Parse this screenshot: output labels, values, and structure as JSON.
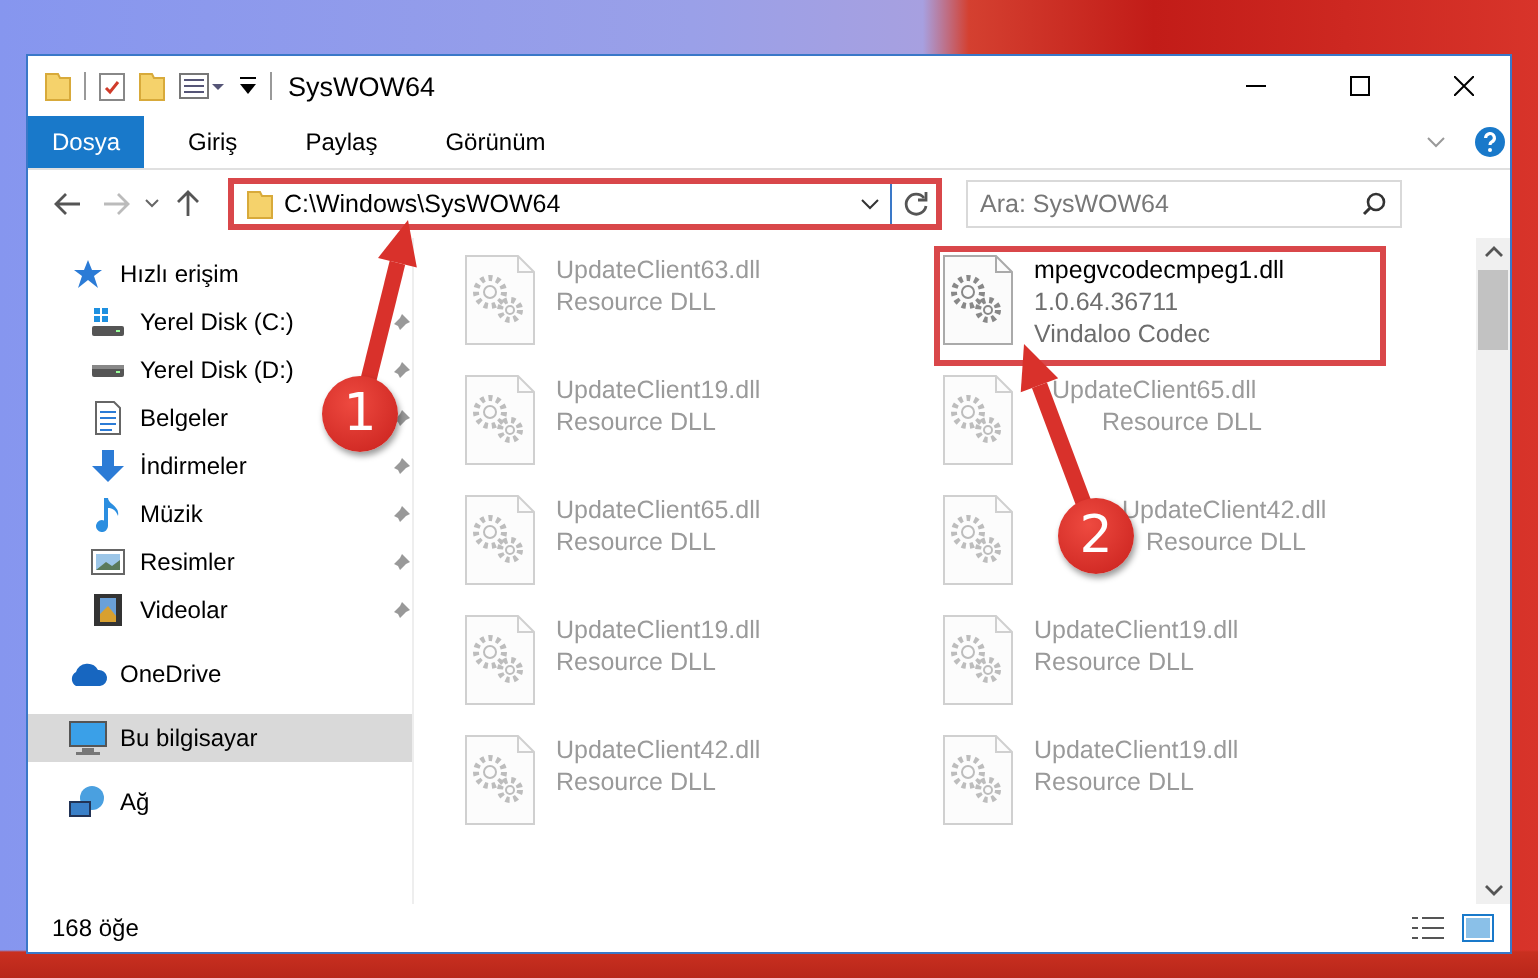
{
  "window": {
    "title": "SysWOW64"
  },
  "ribbon": {
    "tabs": [
      {
        "label": "Dosya",
        "selected": true
      },
      {
        "label": "Giriş",
        "selected": false
      },
      {
        "label": "Paylaş",
        "selected": false
      },
      {
        "label": "Görünüm",
        "selected": false
      }
    ]
  },
  "address_bar": {
    "path": "C:\\Windows\\SysWOW64",
    "highlighted": true
  },
  "search": {
    "placeholder": "Ara: SysWOW64"
  },
  "navigation": [
    {
      "label": "Hızlı erişim",
      "kind": "star",
      "selected": false,
      "children": [
        {
          "label": "Yerel Disk (C:)",
          "kind": "drive-windows",
          "pinned": true,
          "selected": false
        },
        {
          "label": "Yerel Disk (D:)",
          "kind": "drive",
          "pinned": true,
          "selected": false
        },
        {
          "label": "Belgeler",
          "kind": "document",
          "pinned": true,
          "selected": false
        },
        {
          "label": "İndirmeler",
          "kind": "download",
          "pinned": true,
          "selected": false
        },
        {
          "label": "Müzik",
          "kind": "music",
          "pinned": true,
          "selected": false
        },
        {
          "label": "Resimler",
          "kind": "picture",
          "pinned": true,
          "selected": false
        },
        {
          "label": "Videolar",
          "kind": "video",
          "pinned": true,
          "selected": false
        }
      ]
    },
    {
      "label": "OneDrive",
      "kind": "cloud",
      "selected": false
    },
    {
      "label": "Bu bilgisayar",
      "kind": "computer",
      "selected": true
    },
    {
      "label": "Ağ",
      "kind": "network",
      "selected": false
    }
  ],
  "files": [
    {
      "lines": [
        "UpdateClient63.dll",
        "Resource DLL"
      ],
      "faded": true,
      "highlighted": false
    },
    {
      "lines": [
        "mpegvcodecmpeg1.dll",
        "1.0.64.36711",
        "Vindaloo Codec"
      ],
      "faded": false,
      "highlighted": true
    },
    {
      "lines": [
        "UpdateClient19.dll",
        "Resource DLL"
      ],
      "faded": true,
      "highlighted": false
    },
    {
      "lines": [
        "UpdateClient65.dll",
        "Resource DLL"
      ],
      "faded": true,
      "highlighted": false
    },
    {
      "lines": [
        "UpdateClient65.dll",
        "Resource DLL"
      ],
      "faded": true,
      "highlighted": false
    },
    {
      "lines": [
        "UpdateClient42.dll",
        "Resource DLL"
      ],
      "faded": true,
      "highlighted": false
    },
    {
      "lines": [
        "UpdateClient19.dll",
        "Resource DLL"
      ],
      "faded": true,
      "highlighted": false
    },
    {
      "lines": [
        "UpdateClient19.dll",
        "Resource DLL"
      ],
      "faded": true,
      "highlighted": false
    },
    {
      "lines": [
        "UpdateClient42.dll",
        "Resource DLL"
      ],
      "faded": true,
      "highlighted": false
    },
    {
      "lines": [
        "UpdateClient19.dll",
        "Resource DLL"
      ],
      "faded": true,
      "highlighted": false
    }
  ],
  "status_bar": {
    "item_count": "168 öğe"
  },
  "annotations": [
    {
      "number": "1"
    },
    {
      "number": "2"
    }
  ]
}
